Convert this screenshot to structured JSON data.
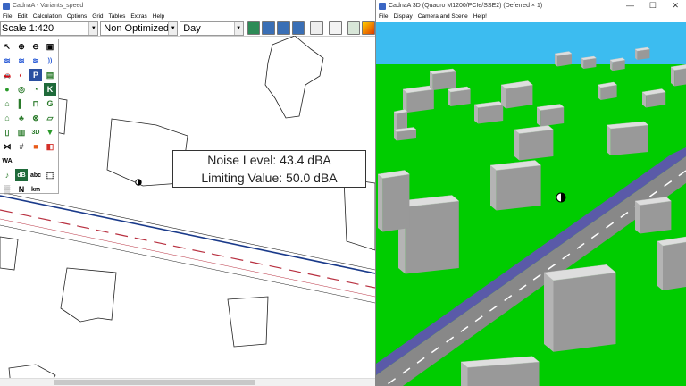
{
  "left_window": {
    "title": "CadnaA - Variants_speed",
    "menu": [
      "File",
      "Edit",
      "Calculation",
      "Options",
      "Grid",
      "Tables",
      "Extras",
      "Help"
    ],
    "scale": "Scale 1:420",
    "optimization": "Non Optimized Ba",
    "period": "Day",
    "toolbar_icons": [
      "open-icon",
      "save-icon",
      "save-as-icon",
      "save-all-icon",
      "print-icon",
      "report-icon",
      "calculator-icon",
      "color-grid-icon"
    ],
    "palette": [
      {
        "name": "pointer-tool-icon",
        "glyph": "↖",
        "color": "#000000"
      },
      {
        "name": "zoom-in-icon",
        "glyph": "⊕",
        "color": "#000000"
      },
      {
        "name": "zoom-out-icon",
        "glyph": "⊖",
        "color": "#000000"
      },
      {
        "name": "zoom-window-icon",
        "glyph": "▣",
        "color": "#000000"
      },
      {
        "name": "source-wave-icon",
        "glyph": "≋",
        "color": "#2a5bd7"
      },
      {
        "name": "area-source-icon",
        "glyph": "≋",
        "color": "#2a5bd7"
      },
      {
        "name": "line-source-icon",
        "glyph": "≋",
        "color": "#2a5bd7"
      },
      {
        "name": "signal-icon",
        "glyph": "))",
        "color": "#2a5bd7"
      },
      {
        "name": "car-icon",
        "glyph": "🚗",
        "color": "#1f6fb5"
      },
      {
        "name": "traffic-light-icon",
        "glyph": "◐",
        "color": "#cc2222"
      },
      {
        "name": "parking-icon",
        "glyph": "P",
        "color": "#ffffff"
      },
      {
        "name": "train-icon",
        "glyph": "▤",
        "color": "#2a7a2a"
      },
      {
        "name": "receiver-point-icon",
        "glyph": "●",
        "color": "#2a9a2a"
      },
      {
        "name": "antenna-icon",
        "glyph": "◎",
        "color": "#2a7a2a"
      },
      {
        "name": "gauge-icon",
        "glyph": "◔",
        "color": "#2a7a2a"
      },
      {
        "name": "k-icon",
        "glyph": "K",
        "color": "#ffffff"
      },
      {
        "name": "building-icon",
        "glyph": "⌂",
        "color": "#2a7a2a"
      },
      {
        "name": "wall-icon",
        "glyph": "▌",
        "color": "#2a7a2a"
      },
      {
        "name": "bridge-icon",
        "glyph": "⊓",
        "color": "#2a7a2a"
      },
      {
        "name": "g-icon",
        "glyph": "G",
        "color": "#2a7a2a"
      },
      {
        "name": "house-icon",
        "glyph": "⌂",
        "color": "#2a7a2a"
      },
      {
        "name": "tree-icon",
        "glyph": "♣",
        "color": "#2a7a2a"
      },
      {
        "name": "crosshair-icon",
        "glyph": "⊗",
        "color": "#2a7a2a"
      },
      {
        "name": "polygon-icon",
        "glyph": "▱",
        "color": "#2a7a2a"
      },
      {
        "name": "cylinder-icon",
        "glyph": "▯",
        "color": "#2a7a2a"
      },
      {
        "name": "barrier-icon",
        "glyph": "▥",
        "color": "#2a7a2a"
      },
      {
        "name": "3d-icon",
        "glyph": "3D",
        "color": "#2a7a2a"
      },
      {
        "name": "terrain-icon",
        "glyph": "▼",
        "color": "#2a9a2a"
      },
      {
        "name": "bowtie-icon",
        "glyph": "⋈",
        "color": "#000000"
      },
      {
        "name": "grid-icon",
        "glyph": "#",
        "color": "#555555"
      },
      {
        "name": "color-map-icon",
        "glyph": "■",
        "color": "#e85b1a"
      },
      {
        "name": "palette-icon",
        "glyph": "◧",
        "color": "#d4302a"
      },
      {
        "name": "wa-icon",
        "glyph": "WA",
        "color": "#000000"
      },
      {
        "name": "blank-1-icon",
        "glyph": "",
        "color": "#000000"
      },
      {
        "name": "blank-2-icon",
        "glyph": "",
        "color": "#000000"
      },
      {
        "name": "blank-3-icon",
        "glyph": "",
        "color": "#000000"
      },
      {
        "name": "noise-marker-icon",
        "glyph": "♪",
        "color": "#2a7a2a"
      },
      {
        "name": "db-icon",
        "glyph": "dB",
        "color": "#ffffff"
      },
      {
        "name": "text-abc-icon",
        "glyph": "abc",
        "color": "#000000"
      },
      {
        "name": "frame-icon",
        "glyph": "⬚",
        "color": "#000000"
      },
      {
        "name": "hatch-icon",
        "glyph": "▒",
        "color": "#555555"
      },
      {
        "name": "north-arrow-icon",
        "glyph": "N",
        "color": "#000000"
      },
      {
        "name": "scale-bar-icon",
        "glyph": "km",
        "color": "#000000"
      },
      {
        "name": "blank-4-icon",
        "glyph": "",
        "color": "#000000"
      }
    ],
    "tooltip": {
      "noise_level": "Noise Level: 43.4 dBA",
      "limiting_value": "Limiting Value: 50.0 dBA"
    }
  },
  "right_window": {
    "title": "CadnaA 3D (Quadro M1200/PCIe/SSE2) (Deferred × 1)",
    "menu": [
      "File",
      "Display",
      "Camera and Scene",
      "Help!"
    ],
    "colors": {
      "sky": "#3cbcf0",
      "grass": "#00cc00",
      "road": "#888888",
      "sidewalk": "#5a5aa8",
      "building_top": "#dedede",
      "building_side": "#999999"
    }
  }
}
